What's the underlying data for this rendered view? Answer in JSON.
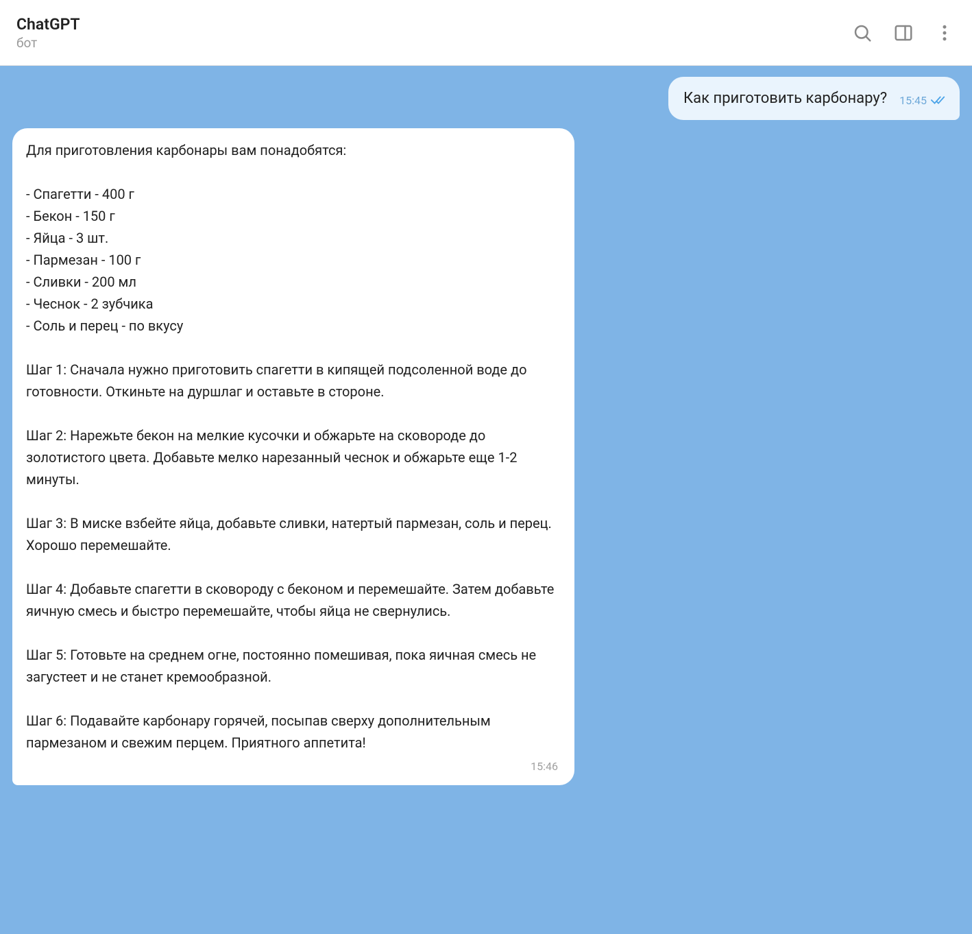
{
  "header": {
    "title": "ChatGPT",
    "subtitle": "бот"
  },
  "messages": {
    "user": {
      "text": "Как приготовить карбонару?",
      "time": "15:45"
    },
    "bot": {
      "text": "Для приготовления карбонары вам понадобятся:\n\n- Спагетти - 400 г\n- Бекон - 150 г\n- Яйца - 3 шт.\n- Пармезан - 100 г\n- Сливки - 200 мл\n- Чеснок - 2 зубчика\n- Соль и перец - по вкусу\n\nШаг 1: Сначала нужно приготовить спагетти в кипящей подсоленной воде до готовности. Откиньте на дуршлаг и оставьте в стороне.\n\nШаг 2: Нарежьте бекон на мелкие кусочки и обжарьте на сковороде до золотистого цвета. Добавьте мелко нарезанный чеснок и обжарьте еще 1-2 минуты.\n\nШаг 3: В миске взбейте яйца, добавьте сливки, натертый пармезан, соль и перец. Хорошо перемешайте.\n\nШаг 4: Добавьте спагетти в сковороду с беконом и перемешайте. Затем добавьте яичную смесь и быстро перемешайте, чтобы яйца не свернулись.\n\nШаг 5: Готовьте на среднем огне, постоянно помешивая, пока яичная смесь не загустеет и не станет кремообразной.\n\nШаг 6: Подавайте карбонару горячей, посыпав сверху дополнительным пармезаном и свежим перцем. Приятного аппетита!",
      "time": "15:46"
    }
  }
}
